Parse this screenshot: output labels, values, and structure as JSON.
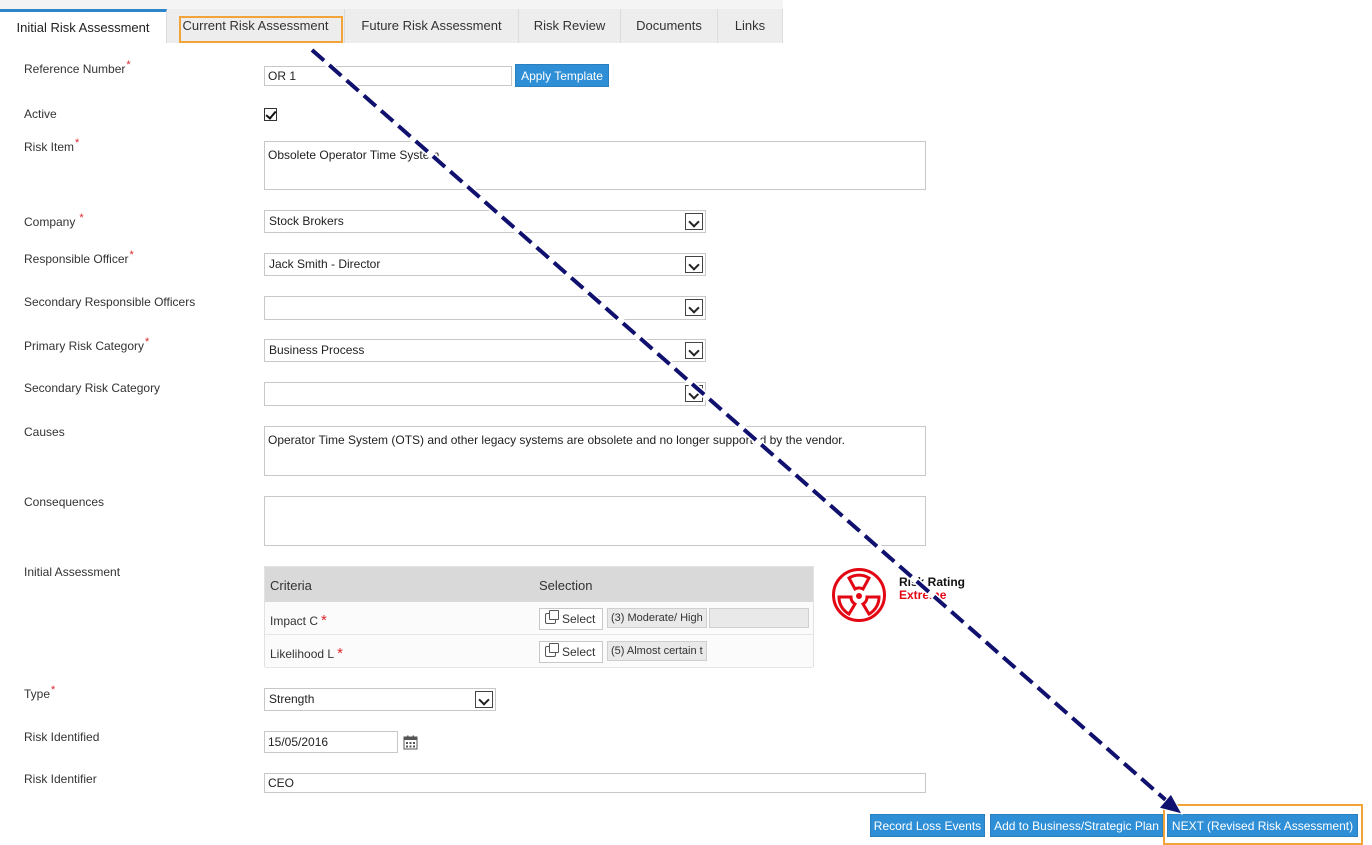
{
  "tabs": [
    {
      "label": "Initial Risk Assessment",
      "active": true
    },
    {
      "label": "Current Risk Assessment",
      "active": false
    },
    {
      "label": "Future Risk Assessment",
      "active": false
    },
    {
      "label": "Risk Review",
      "active": false
    },
    {
      "label": "Documents",
      "active": false
    },
    {
      "label": "Links",
      "active": false
    }
  ],
  "form": {
    "reference_number": {
      "label": "Reference Number",
      "required_mark": "*",
      "value": "OR 1"
    },
    "apply_template_label": "Apply Template",
    "active": {
      "label": "Active",
      "checked": true
    },
    "risk_item": {
      "label": "Risk Item",
      "required_mark": "*",
      "value": "Obsolete Operator Time System"
    },
    "company": {
      "label": "Company",
      "required_mark": "*",
      "value": "Stock Brokers"
    },
    "responsible_officer": {
      "label": "Responsible Officer",
      "required_mark": "*",
      "value": "Jack Smith - Director"
    },
    "secondary_responsible_officers": {
      "label": "Secondary Responsible Officers",
      "value": ""
    },
    "primary_risk_category": {
      "label": "Primary Risk Category",
      "required_mark": "*",
      "value": "Business Process"
    },
    "secondary_risk_category": {
      "label": "Secondary Risk Category",
      "value": ""
    },
    "causes": {
      "label": "Causes",
      "value": "Operator Time System (OTS) and other legacy systems are obsolete and no longer supported by the vendor."
    },
    "consequences": {
      "label": "Consequences",
      "value": ""
    },
    "initial_assessment": {
      "label": "Initial Assessment",
      "header_criteria": "Criteria",
      "header_selection": "Selection",
      "rows": [
        {
          "criteria": "Impact C",
          "required_mark": "*",
          "button": "Select",
          "value": "(3) Moderate/ High",
          "extra": ""
        },
        {
          "criteria": "Likelihood L",
          "required_mark": "*",
          "button": "Select",
          "value": "(5) Almost certain t"
        }
      ],
      "rating_label": "Risk Rating",
      "rating_value": "Extreme",
      "rating_color": "#e30613"
    },
    "type": {
      "label": "Type",
      "required_mark": "*",
      "value": "Strength"
    },
    "risk_identified": {
      "label": "Risk Identified",
      "value": "15/05/2016"
    },
    "risk_identifier": {
      "label": "Risk Identifier",
      "value": "CEO"
    }
  },
  "footer": {
    "record_loss_events": "Record Loss Events",
    "add_to_plan": "Add to Business/Strategic Plan",
    "next": "NEXT (Revised Risk Assessment)"
  },
  "icons": {
    "rating": "radiation-hazard-icon",
    "calendar": "calendar-icon",
    "select": "copy-icon",
    "dropdown": "chevron-down-icon"
  },
  "colors": {
    "accent": "#2e8fd6",
    "highlight": "#f2a33a",
    "annotation_arrow": "#10106e"
  }
}
